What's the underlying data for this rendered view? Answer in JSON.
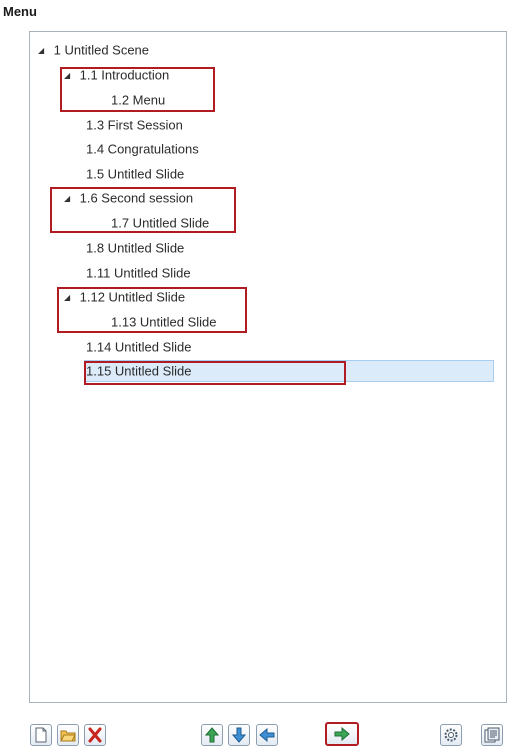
{
  "panel": {
    "title": "Menu"
  },
  "tree": {
    "items": [
      {
        "label": "1 Untitled Scene",
        "expanded": true,
        "level": 0
      },
      {
        "label": "1.1 Introduction",
        "expanded": true,
        "level": 1
      },
      {
        "label": "1.2 Menu",
        "level": 2
      },
      {
        "label": "1.3 First Session",
        "level": 1
      },
      {
        "label": "1.4 Congratulations",
        "level": 1
      },
      {
        "label": "1.5 Untitled Slide",
        "level": 1
      },
      {
        "label": "1.6 Second session",
        "expanded": true,
        "level": 1
      },
      {
        "label": "1.7 Untitled Slide",
        "level": 2
      },
      {
        "label": "1.8 Untitled Slide",
        "level": 1
      },
      {
        "label": "1.11 Untitled Slide",
        "level": 1
      },
      {
        "label": "1.12 Untitled Slide",
        "expanded": true,
        "level": 1
      },
      {
        "label": "1.13 Untitled Slide",
        "level": 2
      },
      {
        "label": "1.14 Untitled Slide",
        "level": 1
      },
      {
        "label": "1.15 Untitled Slide",
        "level": 1,
        "selected": true
      }
    ],
    "expand_glyph": "◢"
  },
  "toolbar": {
    "buttons": [
      {
        "name": "new-page-icon"
      },
      {
        "name": "open-folder-icon"
      },
      {
        "name": "delete-icon"
      },
      {
        "name": "move-up-icon"
      },
      {
        "name": "move-down-icon"
      },
      {
        "name": "outdent-left-icon"
      },
      {
        "name": "indent-right-icon"
      },
      {
        "name": "settings-gear-icon"
      },
      {
        "name": "properties-icon"
      }
    ]
  },
  "colors": {
    "highlight_border": "#b01c22",
    "selection_bg": "#dcebfa",
    "arrow_green": "#3aa655",
    "arrow_blue": "#3c8fd4"
  }
}
